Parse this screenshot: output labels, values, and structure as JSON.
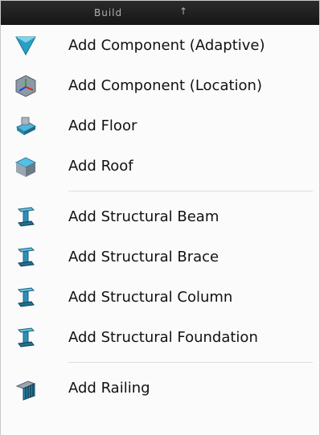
{
  "header": {
    "title": "Build",
    "arrow_icon": "up-arrow-icon"
  },
  "menu": {
    "group1": [
      {
        "label": "Add Component (Adaptive)",
        "icon": "adaptive-component-icon"
      },
      {
        "label": "Add Component (Location)",
        "icon": "location-component-icon"
      },
      {
        "label": "Add Floor",
        "icon": "floor-icon"
      },
      {
        "label": "Add Roof",
        "icon": "roof-icon"
      }
    ],
    "group2": [
      {
        "label": "Add Structural Beam",
        "icon": "structural-beam-icon"
      },
      {
        "label": "Add Structural Brace",
        "icon": "structural-brace-icon"
      },
      {
        "label": "Add Structural Column",
        "icon": "structural-column-icon"
      },
      {
        "label": "Add Structural Foundation",
        "icon": "structural-foundation-icon"
      }
    ],
    "group3": [
      {
        "label": "Add Railing",
        "icon": "railing-icon"
      }
    ]
  }
}
